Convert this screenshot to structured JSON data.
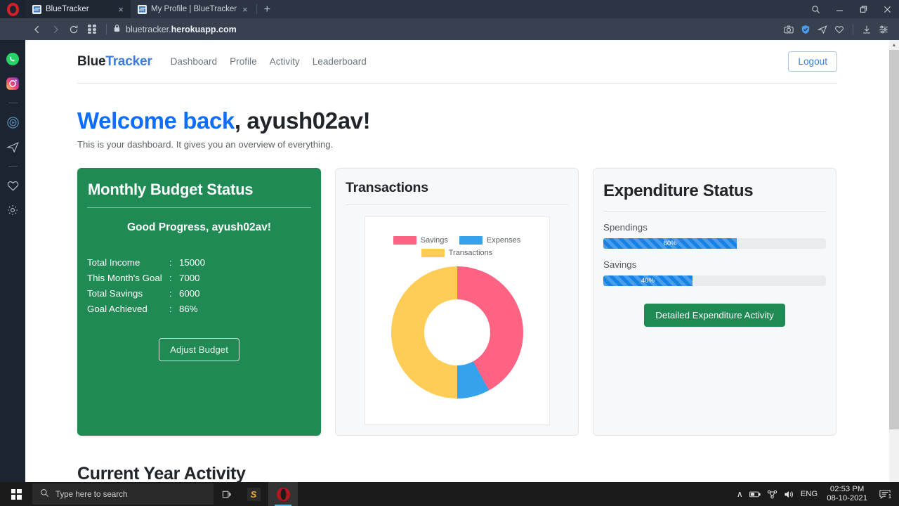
{
  "browser": {
    "tabs": [
      {
        "title": "BlueTracker",
        "active": true
      },
      {
        "title": "My Profile | BlueTracker",
        "active": false
      }
    ],
    "new_tab_label": "+",
    "close_label": "×",
    "window_controls": {
      "search": "⌕",
      "minimize": "—",
      "maximize": "❐",
      "close": "✕"
    },
    "nav": {
      "back": "‹",
      "forward": "›",
      "reload": "↻",
      "tabs_grid": "grid"
    },
    "address": {
      "lock": "lock-icon",
      "domain_prefix": "bluetracker.",
      "domain_bold": "herokuapp.com"
    },
    "toolbar_icons": [
      "snapshot-icon",
      "shield-icon",
      "messenger-icon",
      "heart-icon",
      "download-icon",
      "easy-setup-icon"
    ],
    "sidebar_icons": [
      "whatsapp-icon",
      "instagram-icon",
      "player-icon",
      "telegram-icon",
      "heart-icon",
      "settings-icon"
    ],
    "sidebar_more": "•••"
  },
  "site": {
    "brand": {
      "first": "Blue",
      "second": "Tracker"
    },
    "nav_links": [
      "Dashboard",
      "Profile",
      "Activity",
      "Leaderboard"
    ],
    "logout_label": "Logout",
    "welcome_highlight": "Welcome back",
    "welcome_rest": ", ayush02av!",
    "subtitle": "This is your dashboard. It gives you an overview of everything.",
    "section_heading": "Current Year Activity"
  },
  "budget_card": {
    "title": "Monthly Budget Status",
    "progress_message": "Good Progress, ayush02av!",
    "rows": [
      {
        "label": "Total Income",
        "sep": ":",
        "value": "15000"
      },
      {
        "label": "This Month's Goal",
        "sep": ":",
        "value": "7000"
      },
      {
        "label": "Total Savings",
        "sep": ":",
        "value": "6000"
      },
      {
        "label": "Goal Achieved",
        "sep": ":",
        "value": "86%"
      }
    ],
    "button_label": "Adjust Budget",
    "bg_color": "#1f8a53"
  },
  "transactions_card": {
    "title": "Transactions"
  },
  "expenditure_card": {
    "title": "Expenditure Status",
    "bars": [
      {
        "label": "Spendings",
        "value": 60,
        "text": "60%"
      },
      {
        "label": "Savings",
        "value": 40,
        "text": "40%"
      }
    ],
    "button_label": "Detailed Expenditure Activity",
    "bar_color": "#1582e8",
    "button_color": "#1f8a53"
  },
  "chart_data": {
    "type": "pie",
    "title": "Transactions",
    "variant": "doughnut",
    "labels": [
      "Savings",
      "Expenses",
      "Transactions"
    ],
    "values": [
      42,
      8,
      50
    ],
    "colors": [
      "#fe6384",
      "#36a2eb",
      "#ffcd56"
    ],
    "legend": "top",
    "start_angle": 0,
    "grid": false,
    "xlabel": "",
    "ylabel": ""
  },
  "taskbar": {
    "search_placeholder": "Type here to search",
    "search_icon": "search-icon",
    "task_view_icon": "task-view-icon",
    "apps": [
      {
        "name": "sublime-text",
        "label": "S",
        "active": false
      },
      {
        "name": "opera",
        "label": "O",
        "active": true
      }
    ],
    "tray": {
      "chevron": "∧",
      "icons": [
        "battery-icon",
        "network-icon",
        "volume-icon"
      ],
      "language": "ENG",
      "time": "02:53 PM",
      "date": "08-10-2021",
      "notification_count": "1"
    }
  }
}
